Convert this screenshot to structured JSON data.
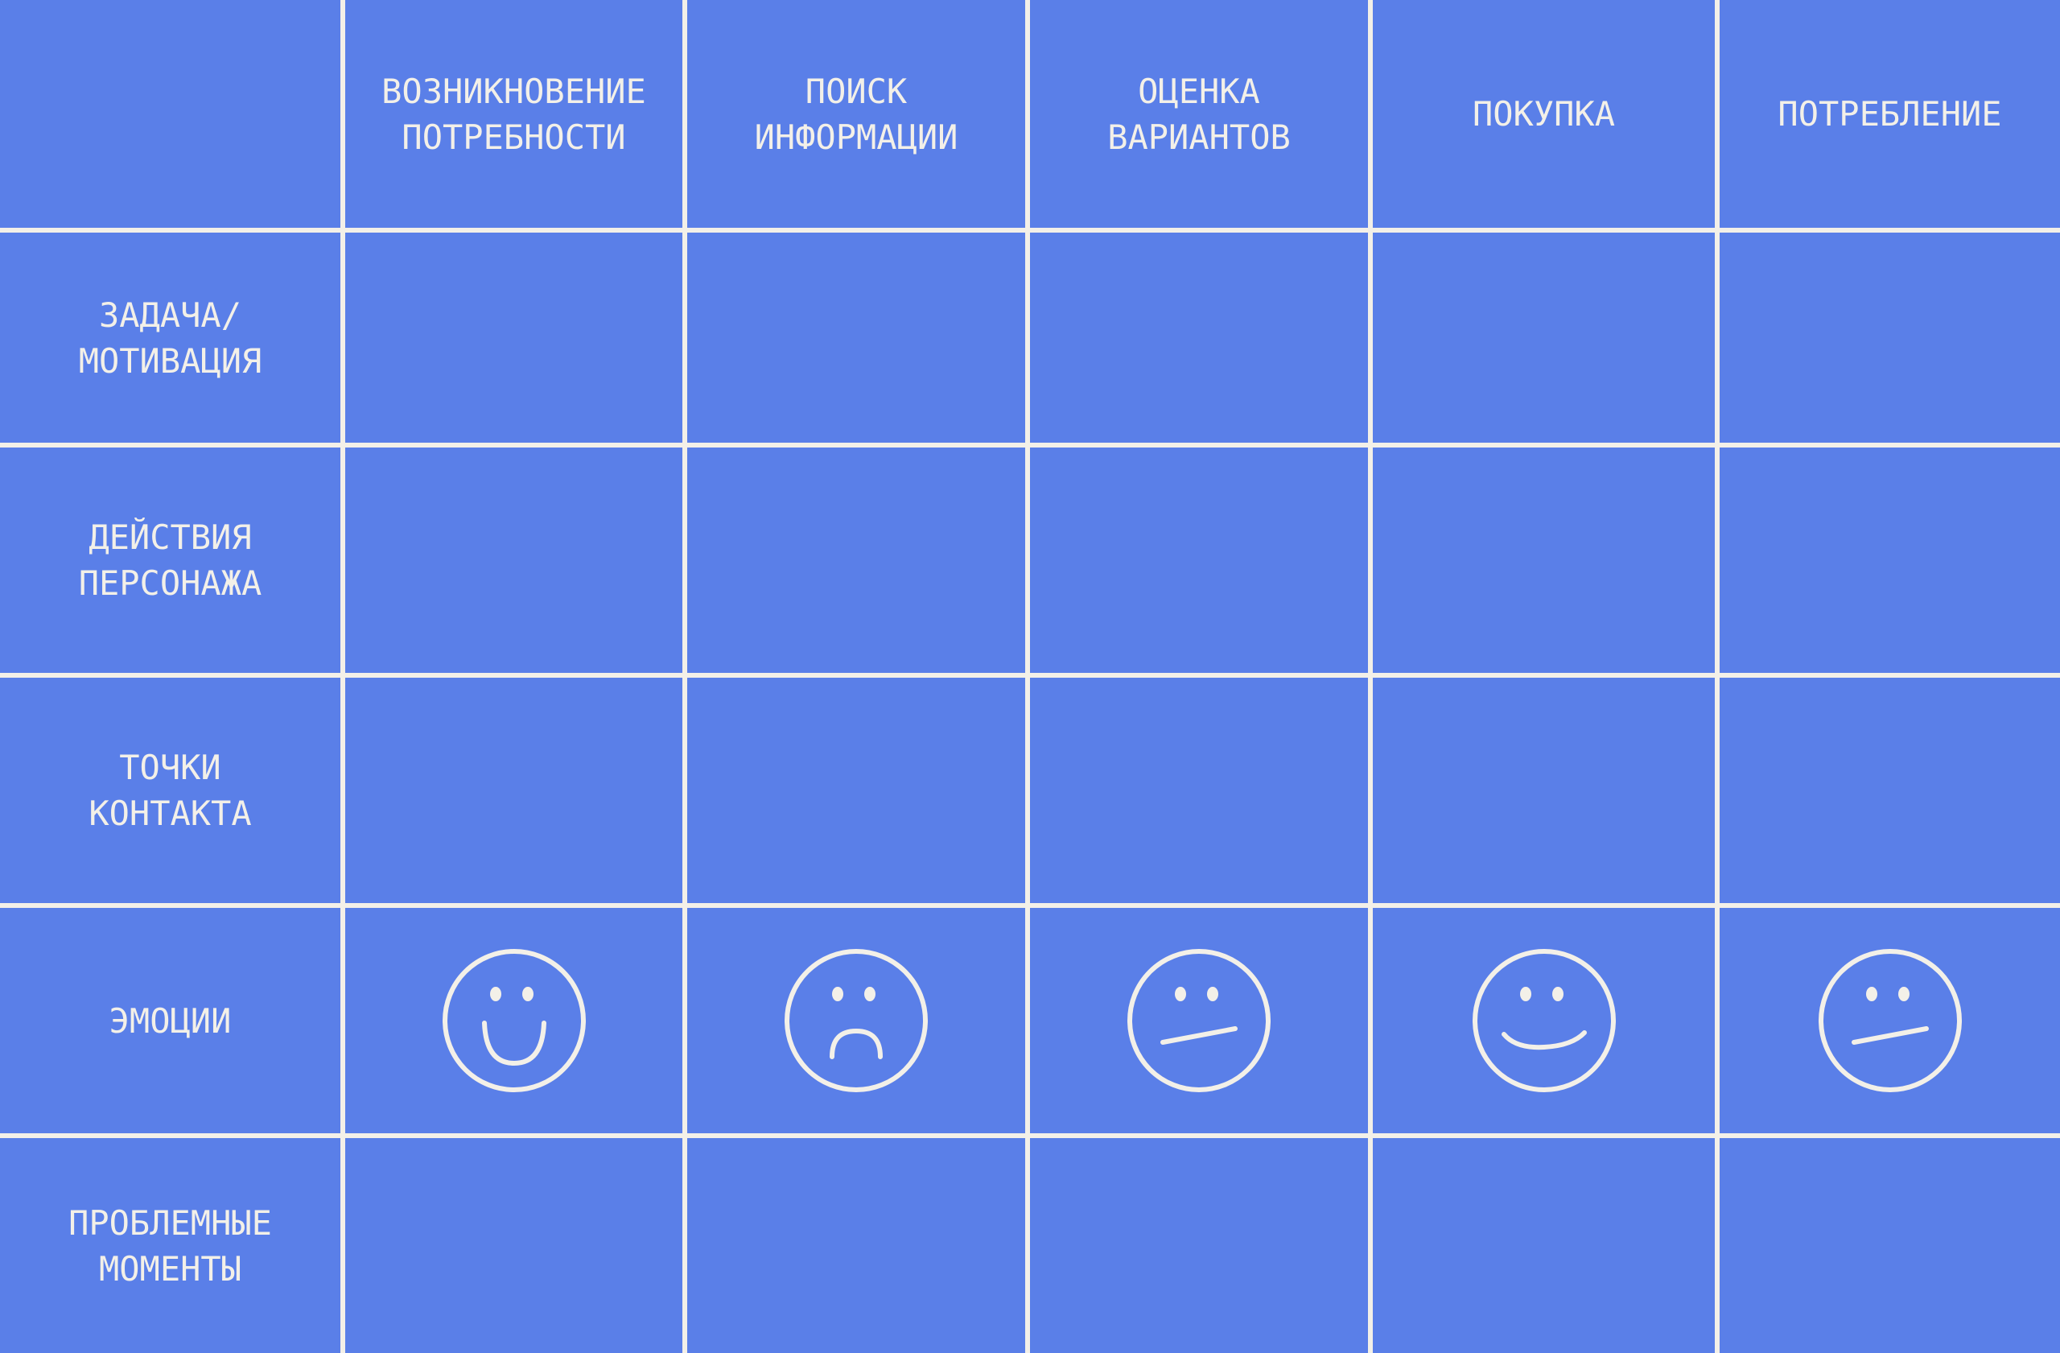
{
  "columns": [
    "ВОЗНИКНОВЕНИЕ\nПОТРЕБНОСТИ",
    "ПОИСК\nИНФОРМАЦИИ",
    "ОЦЕНКА\nВАРИАНТОВ",
    "ПОКУПКА",
    "ПОТРЕБЛЕНИЕ"
  ],
  "rows": [
    "ЗАДАЧА/\nМОТИВАЦИЯ",
    "ДЕЙСТВИЯ\nПЕРСОНАЖА",
    "ТОЧКИ\nКОНТАКТА",
    "ЭМОЦИИ",
    "ПРОБЛЕМНЫЕ\nМОМЕНТЫ"
  ],
  "emotions": [
    "happy",
    "sad",
    "neutral",
    "smile",
    "neutral"
  ],
  "colors": {
    "background": "#5a7fe8",
    "lines": "#f3f0e8"
  }
}
